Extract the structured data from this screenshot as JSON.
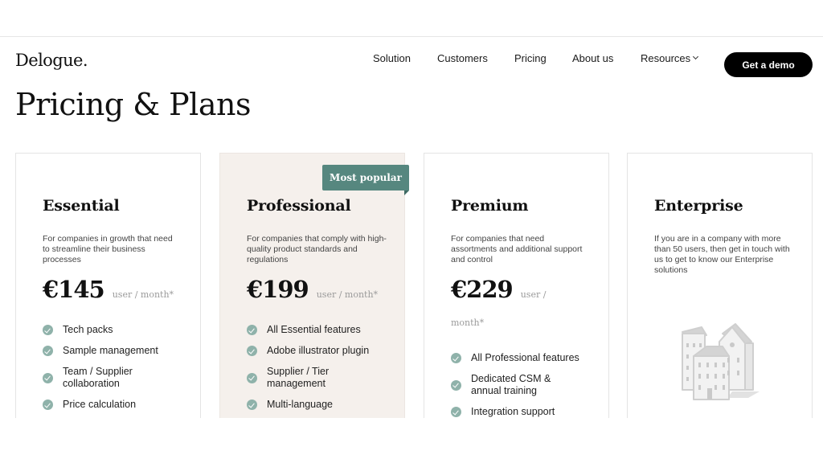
{
  "header": {
    "logo": "Delogue.",
    "nav": [
      {
        "label": "Solution"
      },
      {
        "label": "Customers"
      },
      {
        "label": "Pricing"
      },
      {
        "label": "About us"
      },
      {
        "label": "Resources",
        "has_dropdown": true
      }
    ],
    "cta_label": "Get a demo"
  },
  "page": {
    "title": "Pricing & Plans"
  },
  "plans": [
    {
      "name": "Essential",
      "description": "For companies in growth that need to streamline their business processes",
      "price": "€145",
      "unit": "user / month*",
      "features": [
        "Tech packs",
        "Sample management",
        "Team / Supplier collaboration",
        "Price calculation"
      ]
    },
    {
      "name": "Professional",
      "badge": "Most popular",
      "description": "For companies that comply with high-quality product standards and regulations",
      "price": "€199",
      "unit": "user / month*",
      "features": [
        "All Essential features",
        "Adobe illustrator plugin",
        "Supplier / Tier management",
        "Multi-language"
      ]
    },
    {
      "name": "Premium",
      "description": "For companies that need assortments and additional support and control",
      "price": "€229",
      "unit_line1": "user /",
      "unit_line2": "month*",
      "features": [
        "All Professional features",
        "Dedicated CSM & annual training",
        "Integration support"
      ]
    },
    {
      "name": "Enterprise",
      "description": "If you are in a company with more than 50 users, then get in touch with us to get to know our Enterprise solutions",
      "illustration": "buildings-icon"
    }
  ],
  "colors": {
    "accent": "#56877f",
    "check": "#8fb2aa",
    "highlight_bg": "#f5f0ec",
    "cta_bg": "#000000"
  }
}
